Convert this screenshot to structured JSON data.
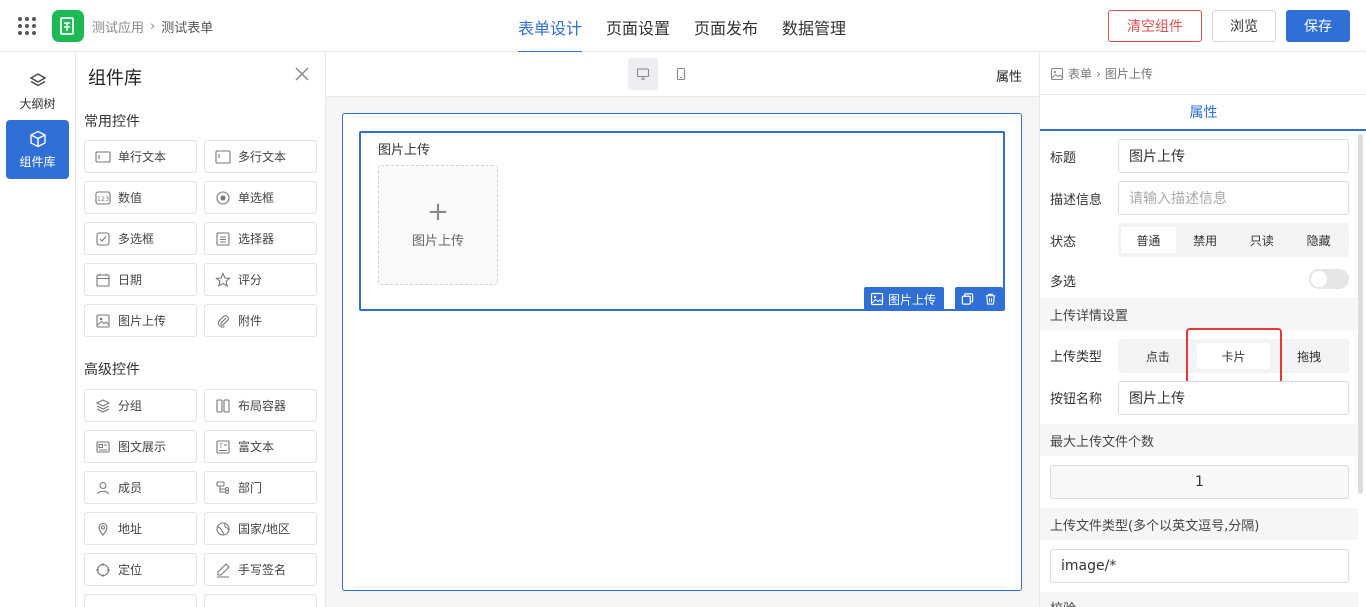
{
  "header": {
    "breadcrumb": [
      "测试应用",
      "测试表单"
    ],
    "tabs": [
      "表单设计",
      "页面设置",
      "页面发布",
      "数据管理"
    ],
    "active_tab": 0,
    "buttons": {
      "clear": "清空组件",
      "preview": "浏览",
      "save": "保存"
    },
    "colors": {
      "primary": "#2f6fd6",
      "danger": "#d9534f",
      "logo": "#1db954"
    }
  },
  "left_nav": [
    {
      "label": "大纲树",
      "icon": "layers-icon"
    },
    {
      "label": "组件库",
      "icon": "cube-icon",
      "active": true
    }
  ],
  "library": {
    "title": "组件库",
    "common_title": "常用控件",
    "common": [
      {
        "label": "单行文本",
        "icon": "single-line-text-icon"
      },
      {
        "label": "多行文本",
        "icon": "multi-line-text-icon"
      },
      {
        "label": "数值",
        "icon": "number-icon"
      },
      {
        "label": "单选框",
        "icon": "radio-icon"
      },
      {
        "label": "多选框",
        "icon": "checkbox-icon"
      },
      {
        "label": "选择器",
        "icon": "select-icon"
      },
      {
        "label": "日期",
        "icon": "calendar-icon"
      },
      {
        "label": "评分",
        "icon": "star-icon"
      },
      {
        "label": "图片上传",
        "icon": "image-icon"
      },
      {
        "label": "附件",
        "icon": "paperclip-icon"
      }
    ],
    "advanced_title": "高级控件",
    "advanced": [
      {
        "label": "分组",
        "icon": "group-icon"
      },
      {
        "label": "布局容器",
        "icon": "layout-icon"
      },
      {
        "label": "图文展示",
        "icon": "image-text-icon"
      },
      {
        "label": "富文本",
        "icon": "rich-text-icon"
      },
      {
        "label": "成员",
        "icon": "user-icon"
      },
      {
        "label": "部门",
        "icon": "department-icon"
      },
      {
        "label": "地址",
        "icon": "location-icon"
      },
      {
        "label": "国家/地区",
        "icon": "globe-icon"
      },
      {
        "label": "定位",
        "icon": "crosshair-icon"
      },
      {
        "label": "手写签名",
        "icon": "pen-icon"
      }
    ]
  },
  "canvas": {
    "properties_link": "属性",
    "field": {
      "label": "图片上传",
      "upload_text": "图片上传",
      "tag": "图片上传"
    }
  },
  "properties": {
    "breadcrumb": [
      "表单",
      "图片上传"
    ],
    "tab": "属性",
    "title_label": "标题",
    "title_value": "图片上传",
    "desc_label": "描述信息",
    "desc_placeholder": "请输入描述信息",
    "status_label": "状态",
    "status_options": [
      "普通",
      "禁用",
      "只读",
      "隐藏"
    ],
    "status_selected": 0,
    "multi_label": "多选",
    "multi_on": false,
    "upload_section": "上传详情设置",
    "upload_type_label": "上传类型",
    "upload_type_options": [
      "点击",
      "卡片",
      "拖拽"
    ],
    "upload_type_selected": 1,
    "button_name_label": "按钮名称",
    "button_name_value": "图片上传",
    "max_files_section": "最大上传文件个数",
    "max_files_value": "1",
    "file_type_section": "上传文件类型(多个以英文逗号,分隔)",
    "file_type_value": "image/*",
    "validation_section": "校验"
  }
}
